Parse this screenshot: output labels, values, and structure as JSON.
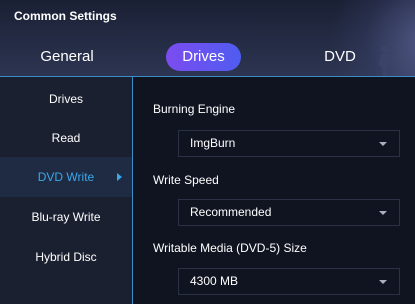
{
  "window": {
    "title": "Common Settings"
  },
  "tabs": {
    "general": "General",
    "drives": "Drives",
    "dvd": "DVD",
    "active": "Drives",
    "active_color": "#6a55f0"
  },
  "sidebar": {
    "items": [
      {
        "label": "Drives",
        "active": false
      },
      {
        "label": "Read",
        "active": false
      },
      {
        "label": "DVD Write",
        "active": true
      },
      {
        "label": "Blu-ray Write",
        "active": false
      },
      {
        "label": "Hybrid Disc",
        "active": false
      }
    ],
    "active_color": "#3aa8ec"
  },
  "settings": {
    "burning_engine": {
      "label": "Burning Engine",
      "value": "ImgBurn"
    },
    "write_speed": {
      "label": "Write Speed",
      "value": "Recommended"
    },
    "writable_media": {
      "label": "Writable Media (DVD-5) Size",
      "value": "4300 MB"
    }
  }
}
